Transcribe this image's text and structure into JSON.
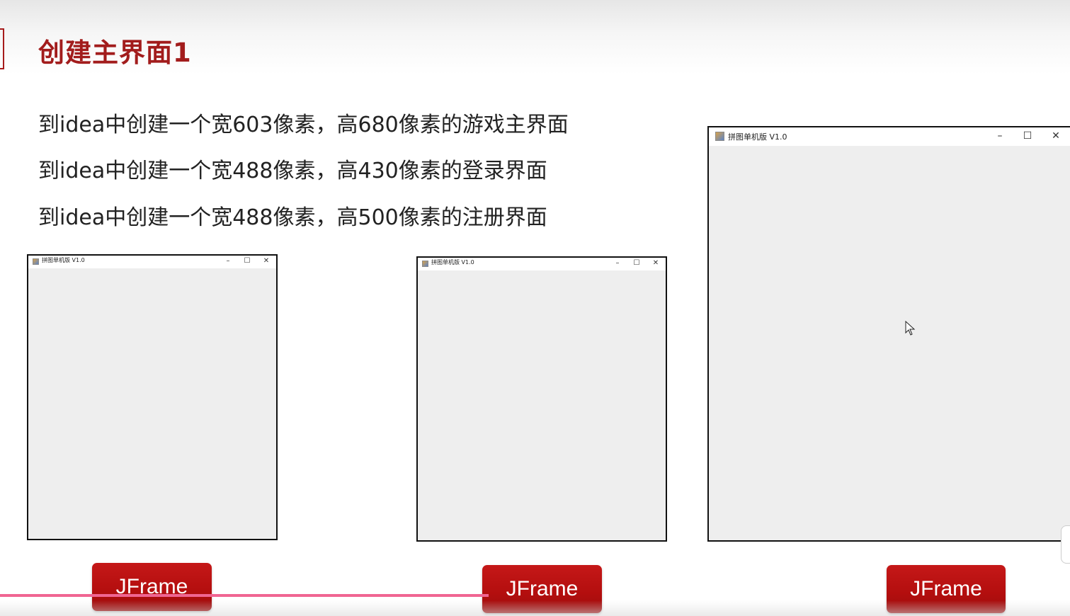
{
  "slide": {
    "title": "创建主界面1",
    "lines": [
      "到idea中创建一个宽603像素，高680像素的游戏主界面",
      "到idea中创建一个宽488像素，高430像素的登录界面",
      "到idea中创建一个宽488像素，高500像素的注册界面"
    ]
  },
  "windows": [
    {
      "title": "拼图单机版 V1.0",
      "minimize": "–",
      "maximize": "☐",
      "close": "✕"
    },
    {
      "title": "拼图单机版 V1.0",
      "minimize": "–",
      "maximize": "☐",
      "close": "✕"
    },
    {
      "title": "拼图单机版 V1.0",
      "minimize": "–",
      "maximize": "☐",
      "close": "✕"
    }
  ],
  "buttons": [
    "JFrame",
    "JFrame",
    "JFrame"
  ],
  "colors": {
    "title_red": "#a21c1c",
    "button_red": "#b30e0e",
    "window_bg": "#eeeeee",
    "progress_pink": "#f06592"
  },
  "icons": [
    "java-app-icon",
    "minimize-icon",
    "maximize-icon",
    "close-icon",
    "mouse-cursor-icon"
  ]
}
